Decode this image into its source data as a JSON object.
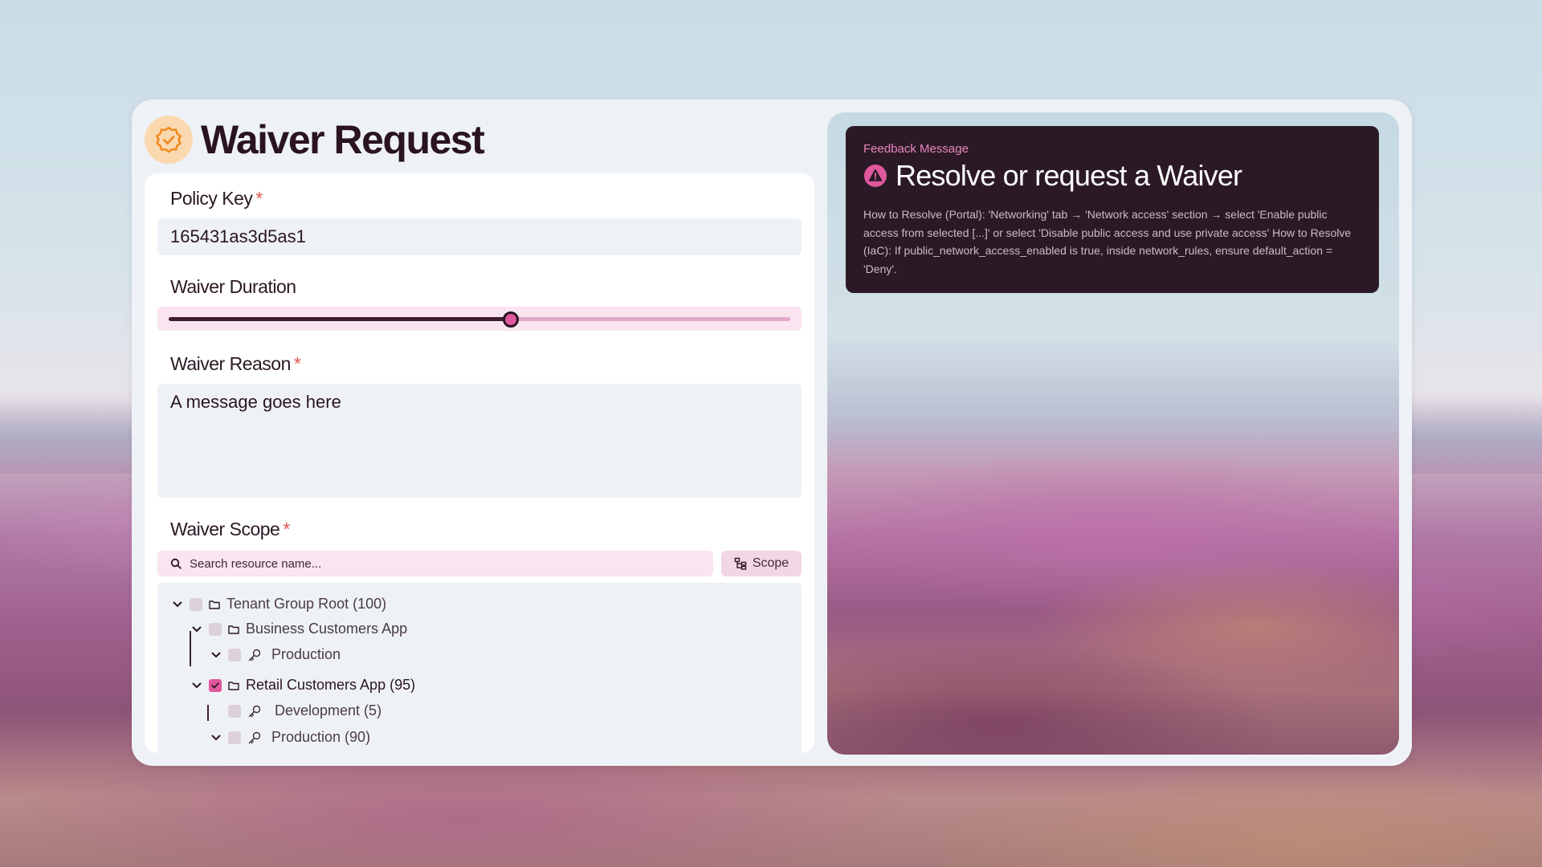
{
  "header": {
    "title": "Waiver Request",
    "icon": "badge-check-icon"
  },
  "form": {
    "policy_key": {
      "label": "Policy Key",
      "required_mark": "*",
      "value": "165431as3d5as1"
    },
    "duration": {
      "label": "Waiver Duration",
      "value_fraction": 0.55
    },
    "reason": {
      "label": "Waiver Reason",
      "required_mark": "*",
      "value": "A message goes here"
    },
    "scope": {
      "label": "Waiver Scope",
      "required_mark": "*",
      "search_placeholder": "Search resource name...",
      "scope_button": "Scope",
      "tree": [
        {
          "label": "Tenant Group Root (100)",
          "checked": false
        },
        {
          "label": "Business Customers App",
          "checked": false
        },
        {
          "label": "Production",
          "checked": false
        },
        {
          "label": "Retail Customers App (95)",
          "checked": true
        },
        {
          "label": "Development (5)",
          "checked": false
        },
        {
          "label": "Production (90)",
          "checked": false
        }
      ]
    }
  },
  "feedback": {
    "kicker": "Feedback Message",
    "title": "Resolve or request a Waiver",
    "body": "How to Resolve (Portal): 'Networking' tab → 'Network access' section → select 'Enable public access from selected [...]' or select 'Disable public access and use private access' How to Resolve (IaC): If public_network_access_enabled is true, inside network_rules, ensure default_action = 'Deny'."
  },
  "colors": {
    "accent": "#e0589d",
    "dark": "#2b1a26",
    "badge": "#fbd9b0",
    "required": "#e0574d"
  }
}
